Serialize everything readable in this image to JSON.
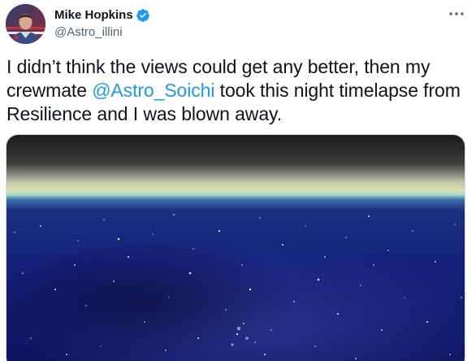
{
  "author": {
    "display_name": "Mike Hopkins",
    "handle": "@Astro_illini"
  },
  "tweet": {
    "text_before": "I didn’t think the views could get any better, then my crewmate ",
    "mention": "@Astro_Soichi",
    "text_after": " took this night timelapse from Resilience and I was blown away."
  },
  "icons": {
    "verified": "verified-badge-icon",
    "more": "more-options-icon"
  },
  "colors": {
    "link": "#1d9bf0",
    "text": "#0f1419",
    "secondary": "#536471"
  }
}
